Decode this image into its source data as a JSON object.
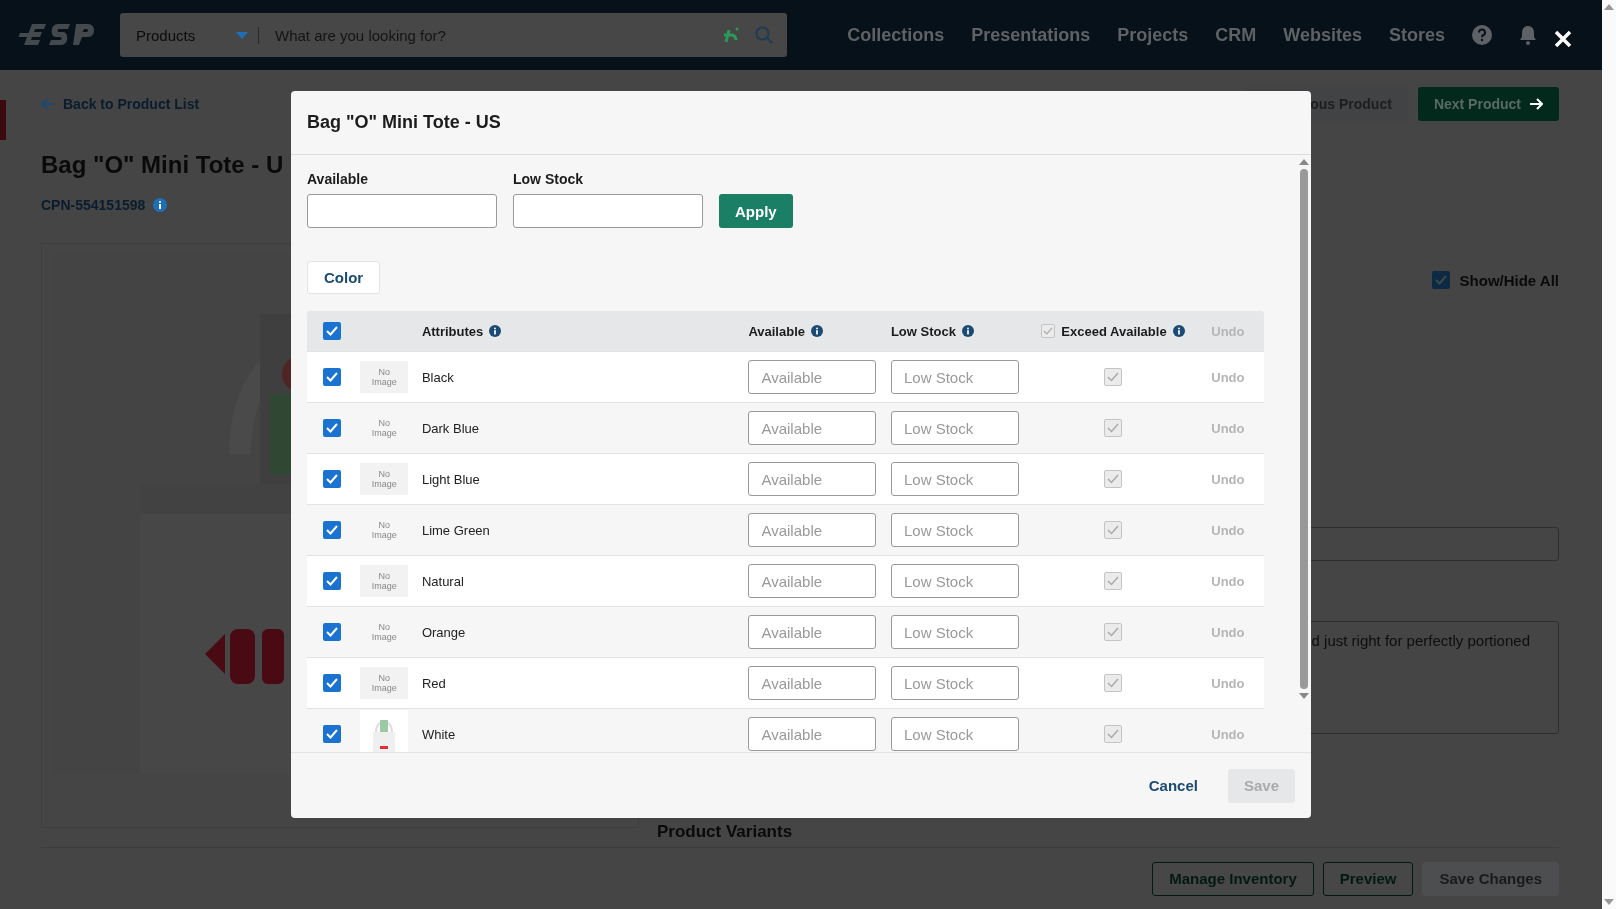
{
  "top_bar": {
    "search": {
      "scope": "Products",
      "placeholder": "What are you looking for?"
    },
    "nav": [
      "Collections",
      "Presentations",
      "Projects",
      "CRM",
      "Websites",
      "Stores"
    ]
  },
  "page": {
    "back_link": "Back to Product List",
    "previous_button": "ous Product",
    "next_button": "Next Product",
    "title": "Bag \"O\" Mini Tote - U",
    "cpn": "CPN-554151598",
    "show_hide_all": {
      "label": "Show/Hide All",
      "checked": true
    },
    "description_text": "d just right for perfectly portioned",
    "section_heading": "Product Variants",
    "footer_buttons": [
      {
        "label": "Manage Inventory",
        "disabled": false
      },
      {
        "label": "Preview",
        "disabled": false
      },
      {
        "label": "Save Changes",
        "disabled": true
      }
    ]
  },
  "modal": {
    "title": "Bag \"O\" Mini Tote - US",
    "bulk": {
      "available_label": "Available",
      "low_stock_label": "Low Stock",
      "apply": "Apply"
    },
    "tabs": [
      {
        "label": "Color",
        "selected": true
      }
    ],
    "table": {
      "all_checked": true,
      "columns": [
        "Attributes",
        "Available",
        "Low Stock",
        "Exceed Available",
        "Undo"
      ],
      "exceed_all_checked": true,
      "rows": [
        {
          "name": "Black",
          "image": "No Image",
          "checked": true,
          "available_placeholder": "Available",
          "low_stock_placeholder": "Low Stock",
          "exceed": true,
          "undo": "Undo"
        },
        {
          "name": "Dark Blue",
          "image": "No Image",
          "checked": true,
          "available_placeholder": "Available",
          "low_stock_placeholder": "Low Stock",
          "exceed": true,
          "undo": "Undo"
        },
        {
          "name": "Light Blue",
          "image": "No Image",
          "checked": true,
          "available_placeholder": "Available",
          "low_stock_placeholder": "Low Stock",
          "exceed": true,
          "undo": "Undo"
        },
        {
          "name": "Lime Green",
          "image": "No Image",
          "checked": true,
          "available_placeholder": "Available",
          "low_stock_placeholder": "Low Stock",
          "exceed": true,
          "undo": "Undo"
        },
        {
          "name": "Natural",
          "image": "No Image",
          "checked": true,
          "available_placeholder": "Available",
          "low_stock_placeholder": "Low Stock",
          "exceed": true,
          "undo": "Undo"
        },
        {
          "name": "Orange",
          "image": "No Image",
          "checked": true,
          "available_placeholder": "Available",
          "low_stock_placeholder": "Low Stock",
          "exceed": true,
          "undo": "Undo"
        },
        {
          "name": "Red",
          "image": "No Image",
          "checked": true,
          "available_placeholder": "Available",
          "low_stock_placeholder": "Low Stock",
          "exceed": true,
          "undo": "Undo"
        },
        {
          "name": "White",
          "kind": "picture",
          "checked": true,
          "available_placeholder": "Available",
          "low_stock_placeholder": "Low Stock",
          "exceed": true,
          "undo": "Undo"
        }
      ]
    },
    "cancel": "Cancel",
    "save": "Save",
    "save_disabled": true
  }
}
